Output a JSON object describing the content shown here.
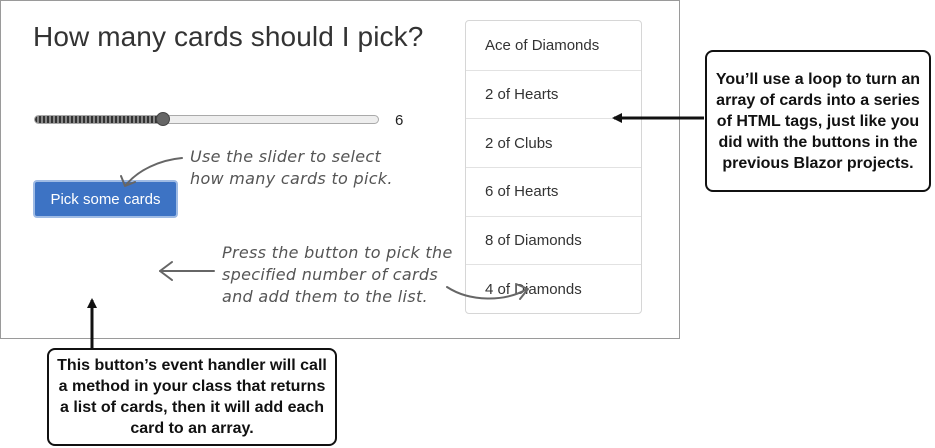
{
  "app": {
    "title": "How many cards should I pick?",
    "slider": {
      "value_label": "6",
      "level_fraction": 0.38
    },
    "button_label": "Pick some cards",
    "cards": [
      "Ace of Diamonds",
      "2 of Hearts",
      "2 of Clubs",
      "6 of Hearts",
      "8 of Diamonds",
      "4 of Diamonds"
    ]
  },
  "annotations": {
    "slider_note": "Use the slider to select how many cards to pick.",
    "button_note": "Press the button to pick the specified number of cards and add them to the list.",
    "list_callout": "You’ll use a loop to turn an array of cards into a series of HTML tags, just like you did with the buttons in the previous Blazor projects.",
    "button_callout": "This button’s event handler will call a method in your class that returns a list of cards, then it will add each card to an array."
  },
  "colors": {
    "button_bg": "#3d73c4",
    "text": "#333333",
    "callout_border": "#111111"
  }
}
